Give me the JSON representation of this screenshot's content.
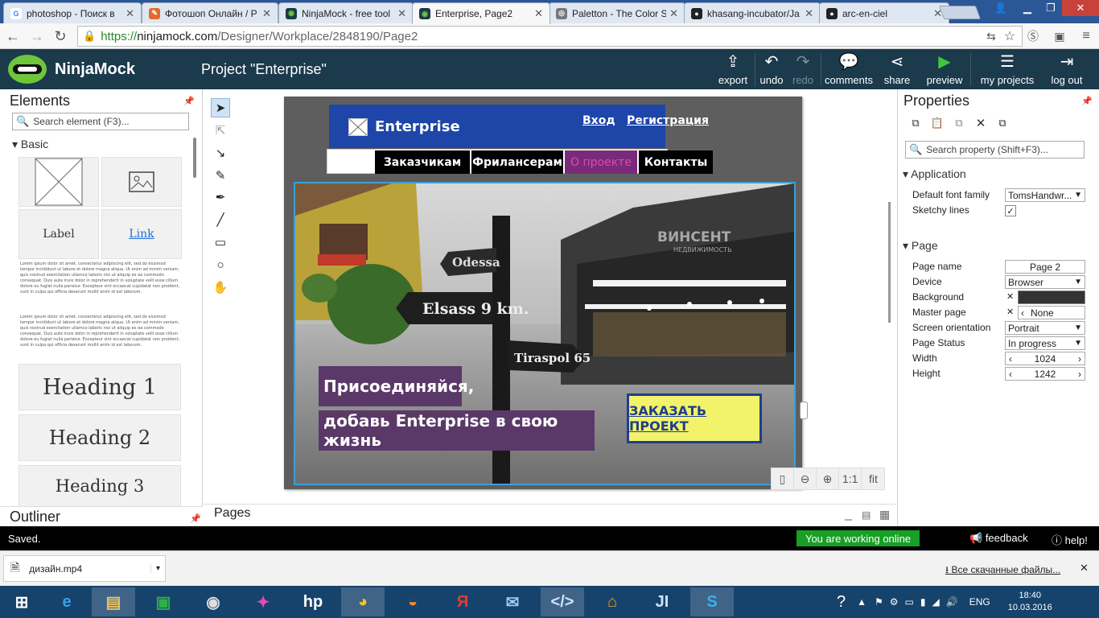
{
  "browser": {
    "tabs": [
      {
        "title": "photoshop - Поиск в",
        "fav": "G",
        "color": "#4285f4"
      },
      {
        "title": "Фотошоп Онлайн / Р",
        "fav": "✎",
        "color": "#e26b2c"
      },
      {
        "title": "NinjaMock - free tool",
        "fav": "◉",
        "color": "#1b3a4b"
      },
      {
        "title": "Enterprise, Page2",
        "fav": "◉",
        "color": "#1b3a4b"
      },
      {
        "title": "Paletton - The Color S",
        "fav": "◎",
        "color": "#777"
      },
      {
        "title": "khasang-incubator/Ja",
        "fav": "●",
        "color": "#222"
      },
      {
        "title": "arc-en-ciel",
        "fav": "●",
        "color": "#222"
      }
    ],
    "url_secure": "https://",
    "url_host": "ninjamock.com",
    "url_path": "/Designer/Workplace/2848190/Page2"
  },
  "app": {
    "logo_text": "NinjaMock",
    "project_title": "Project \"Enterprise\"",
    "toolbar": [
      {
        "label": "export",
        "icon": "⇪",
        "name": "export"
      },
      {
        "label": "undo",
        "icon": "↶",
        "name": "undo"
      },
      {
        "label": "redo",
        "icon": "↷",
        "name": "redo"
      },
      {
        "label": "comments",
        "icon": "💬",
        "name": "comments"
      },
      {
        "label": "share",
        "icon": "⋖",
        "name": "share"
      },
      {
        "label": "preview",
        "icon": "▶",
        "name": "preview"
      },
      {
        "label": "my projects",
        "icon": "☰",
        "name": "my-projects"
      },
      {
        "label": "log out",
        "icon": "⇥",
        "name": "log-out"
      }
    ]
  },
  "elements_panel": {
    "title": "Elements",
    "search_placeholder": "Search element (F3)...",
    "section": "Basic",
    "label_tile": "Label",
    "link_tile": "Link",
    "lorem": "Lorem ipsum dolor sit amet, consectetur adipiscing elit, sed do eiusmod tempor incididunt ut labore et dolore magna aliqua. Ut enim ad minim veniam, quis nostrud exercitation ullamco laboris nisi ut aliquip ex ea commodo consequat. Duis aute irure dolor in reprehenderit in voluptate velit esse cillum dolore eu fugiat nulla pariatur. Excepteur sint occaecat cupidatat non proident, sunt in culpa qui officia deserunt mollit anim id est laborum.",
    "headings": [
      "Heading 1",
      "Heading 2",
      "Heading 3"
    ],
    "outliner": "Outliner"
  },
  "mockup": {
    "brand": "Enterprise",
    "login": "Вход",
    "register": "Регистрация",
    "menu": [
      "Заказчикам",
      "Фрилансерам",
      "О проекте",
      "Контакты"
    ],
    "sign_odessa": "Odessa",
    "sign_elsass": "Elsass 9 km.",
    "sign_tiraspol": "Tiraspol 65",
    "watermark": "ВИНСЕНТ",
    "watermark_sub": "НЕДВИЖИМОСТЬ",
    "headline1": "Присоединяйся,",
    "headline2": "добавь Enterprise в свою жизнь",
    "cta": "ЗАКАЗАТЬ ПРОЕКТ"
  },
  "zoom": {
    "one": "1:1",
    "fit": "fit"
  },
  "pages_label": "Pages",
  "properties": {
    "title": "Properties",
    "search_placeholder": "Search property (Shift+F3)...",
    "application_section": "Application",
    "page_section": "Page",
    "app_rows": [
      {
        "label": "Default font family",
        "value": "TomsHandwr..."
      },
      {
        "label": "Sketchy lines",
        "value": "✓"
      }
    ],
    "page_rows": [
      {
        "label": "Page name",
        "value": "Page 2"
      },
      {
        "label": "Device",
        "value": "Browser"
      },
      {
        "label": "Background",
        "value": ""
      },
      {
        "label": "Master page",
        "value": "None"
      },
      {
        "label": "Screen orientation",
        "value": "Portrait"
      },
      {
        "label": "Page Status",
        "value": "In progress"
      },
      {
        "label": "Width",
        "value": "1024"
      },
      {
        "label": "Height",
        "value": "1242"
      }
    ],
    "background_color": "#333333"
  },
  "status": {
    "saved": "Saved.",
    "online": "You are working online",
    "feedback": "feedback",
    "help": "help!"
  },
  "downloads": {
    "file": "дизайн.mp4",
    "all": "Все скачанные файлы..."
  },
  "taskbar": {
    "lang": "ENG",
    "time": "18:40",
    "date": "10.03.2016"
  }
}
